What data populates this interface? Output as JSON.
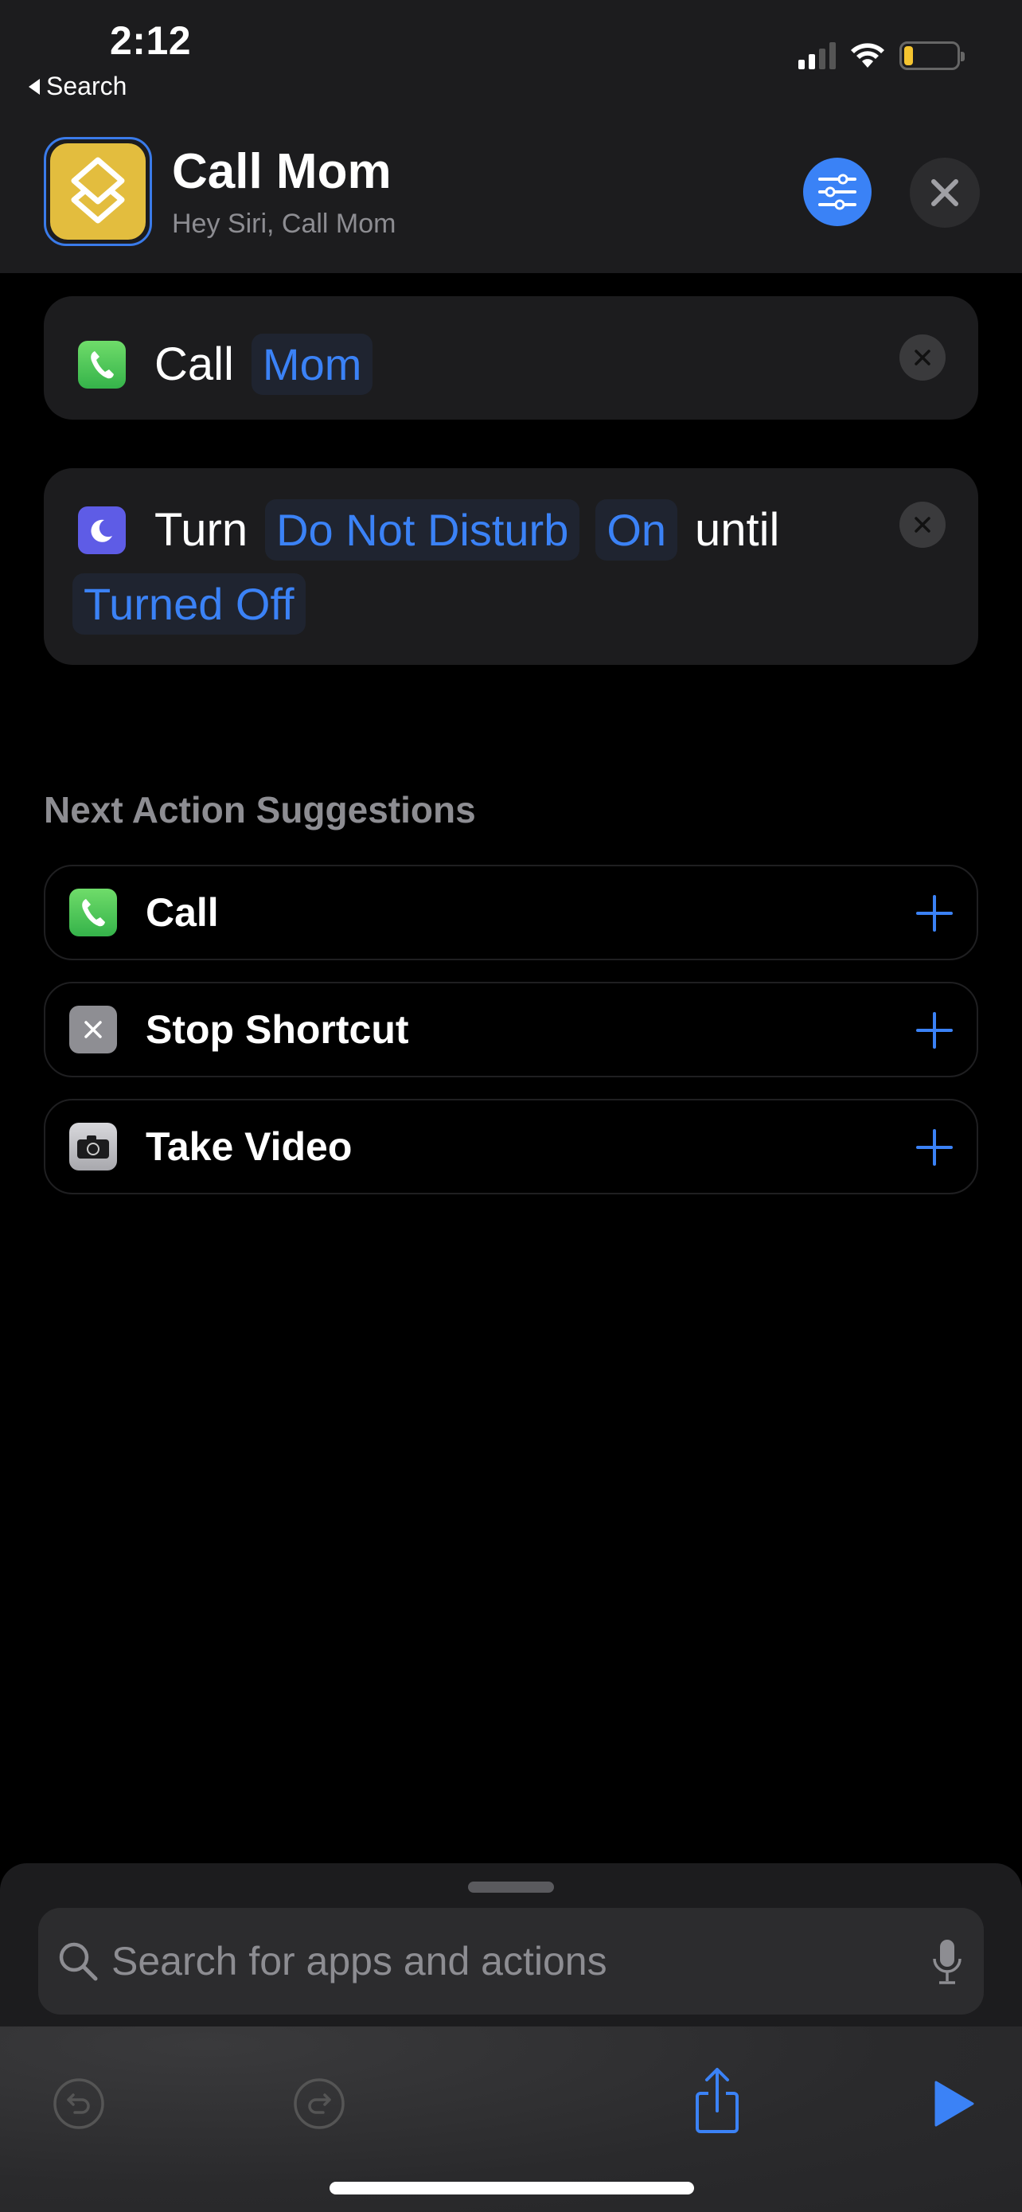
{
  "status_bar": {
    "time": "2:12",
    "back_label": "Search",
    "battery_color": "#f4c430"
  },
  "header": {
    "title": "Call Mom",
    "subtitle": "Hey Siri, Call Mom",
    "icon": "shortcuts-layers-icon",
    "icon_color": "#e3bd3e",
    "settings_icon": "sliders-icon",
    "close_icon": "close-icon",
    "accent": "#3a82f6"
  },
  "actions": [
    {
      "icon": "phone-icon",
      "verb": "Call",
      "params": [
        "Mom"
      ]
    },
    {
      "icon": "moon-icon",
      "verb": "Turn",
      "params": [
        "Do Not Disturb",
        "On"
      ],
      "connector": "until",
      "tail_param": "Turned Off"
    }
  ],
  "suggestions": {
    "title": "Next Action Suggestions",
    "items": [
      {
        "label": "Call",
        "icon": "phone-icon"
      },
      {
        "label": "Stop Shortcut",
        "icon": "stop-x-icon"
      },
      {
        "label": "Take Video",
        "icon": "camera-icon"
      }
    ]
  },
  "search": {
    "placeholder": "Search for apps and actions",
    "value": ""
  },
  "toolbar": {
    "undo": "undo-icon",
    "redo": "redo-icon",
    "share": "share-icon",
    "play": "play-icon"
  }
}
